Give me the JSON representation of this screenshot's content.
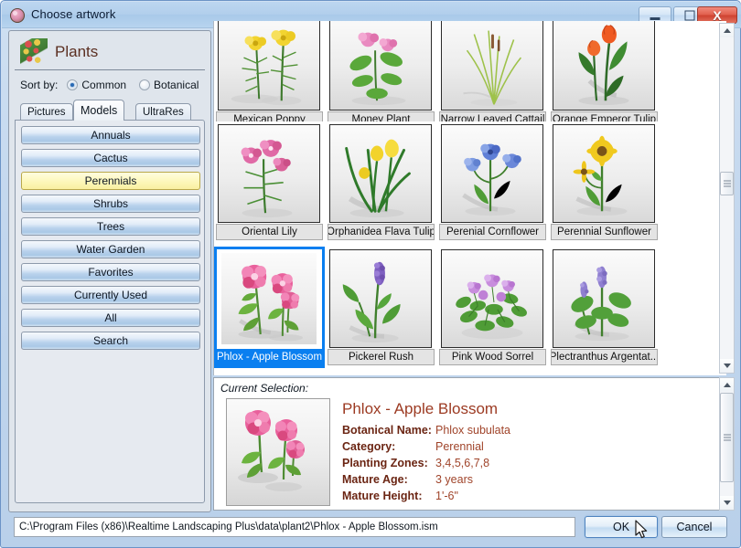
{
  "window": {
    "title": "Choose artwork",
    "icon": "flower-icon",
    "controls": {
      "minimize": "minimize-icon",
      "maximize": "maximize-icon",
      "close": "X"
    }
  },
  "sidebar": {
    "header_title": "Plants",
    "header_icon": "plants-icon",
    "sort_by_label": "Sort by:",
    "sort_options": [
      {
        "label": "Common",
        "checked": true
      },
      {
        "label": "Botanical",
        "checked": false
      }
    ],
    "tabs": [
      {
        "label": "Pictures",
        "active": false
      },
      {
        "label": "Models",
        "active": true
      },
      {
        "label": "UltraRes",
        "active": false
      }
    ],
    "categories": [
      {
        "label": "Annuals",
        "selected": false
      },
      {
        "label": "Cactus",
        "selected": false
      },
      {
        "label": "Perennials",
        "selected": true
      },
      {
        "label": "Shrubs",
        "selected": false
      },
      {
        "label": "Trees",
        "selected": false
      },
      {
        "label": "Water Garden",
        "selected": false
      },
      {
        "label": "Favorites",
        "selected": false
      },
      {
        "label": "Currently Used",
        "selected": false
      },
      {
        "label": "All",
        "selected": false
      },
      {
        "label": "Search",
        "selected": false
      }
    ]
  },
  "grid": {
    "items": [
      {
        "label": "Mexican Poppy",
        "selected": false,
        "art": "poppy"
      },
      {
        "label": "Money Plant",
        "selected": false,
        "art": "money"
      },
      {
        "label": "Narrow Leaved Cattail",
        "selected": false,
        "art": "cattail"
      },
      {
        "label": "Orange Emperor Tulip",
        "selected": false,
        "art": "orangetulip"
      },
      {
        "label": "Oriental Lily",
        "selected": false,
        "art": "lily"
      },
      {
        "label": "Orphanidea Flava Tulip",
        "selected": false,
        "art": "yellowtulip"
      },
      {
        "label": "Perenial Cornflower",
        "selected": false,
        "art": "cornflower"
      },
      {
        "label": "Perennial Sunflower",
        "selected": false,
        "art": "sunflower"
      },
      {
        "label": "Phlox - Apple Blossom",
        "selected": true,
        "art": "phlox"
      },
      {
        "label": "Pickerel Rush",
        "selected": false,
        "art": "pickerel"
      },
      {
        "label": "Pink Wood Sorrel",
        "selected": false,
        "art": "sorrel"
      },
      {
        "label": "Plectranthus Argentat...",
        "selected": false,
        "art": "plectranthus"
      }
    ]
  },
  "detail": {
    "section_label": "Current Selection:",
    "title": "Phlox - Apple Blossom",
    "thumb_icon": "phlox-thumbnail",
    "fields": [
      {
        "key": "Botanical Name:",
        "value": "Phlox subulata"
      },
      {
        "key": "Category:",
        "value": "Perennial"
      },
      {
        "key": "Planting Zones:",
        "value": "3,4,5,6,7,8"
      },
      {
        "key": "Mature Age:",
        "value": "3 years"
      },
      {
        "key": "Mature Height:",
        "value": "1'-6\""
      }
    ]
  },
  "footer": {
    "path": "C:\\Program Files (x86)\\Realtime Landscaping Plus\\data\\plant2\\Phlox - Apple Blossom.ism",
    "ok_label": "OK",
    "cancel_label": "Cancel"
  },
  "colors": {
    "selection_blue": "#0a7ff0",
    "selected_category_yellow": "#fdf8bd",
    "detail_title": "#9c3a22",
    "detail_value": "#a0442a",
    "titlebar": "#b2cfec",
    "close_button_red": "#cf4331"
  }
}
